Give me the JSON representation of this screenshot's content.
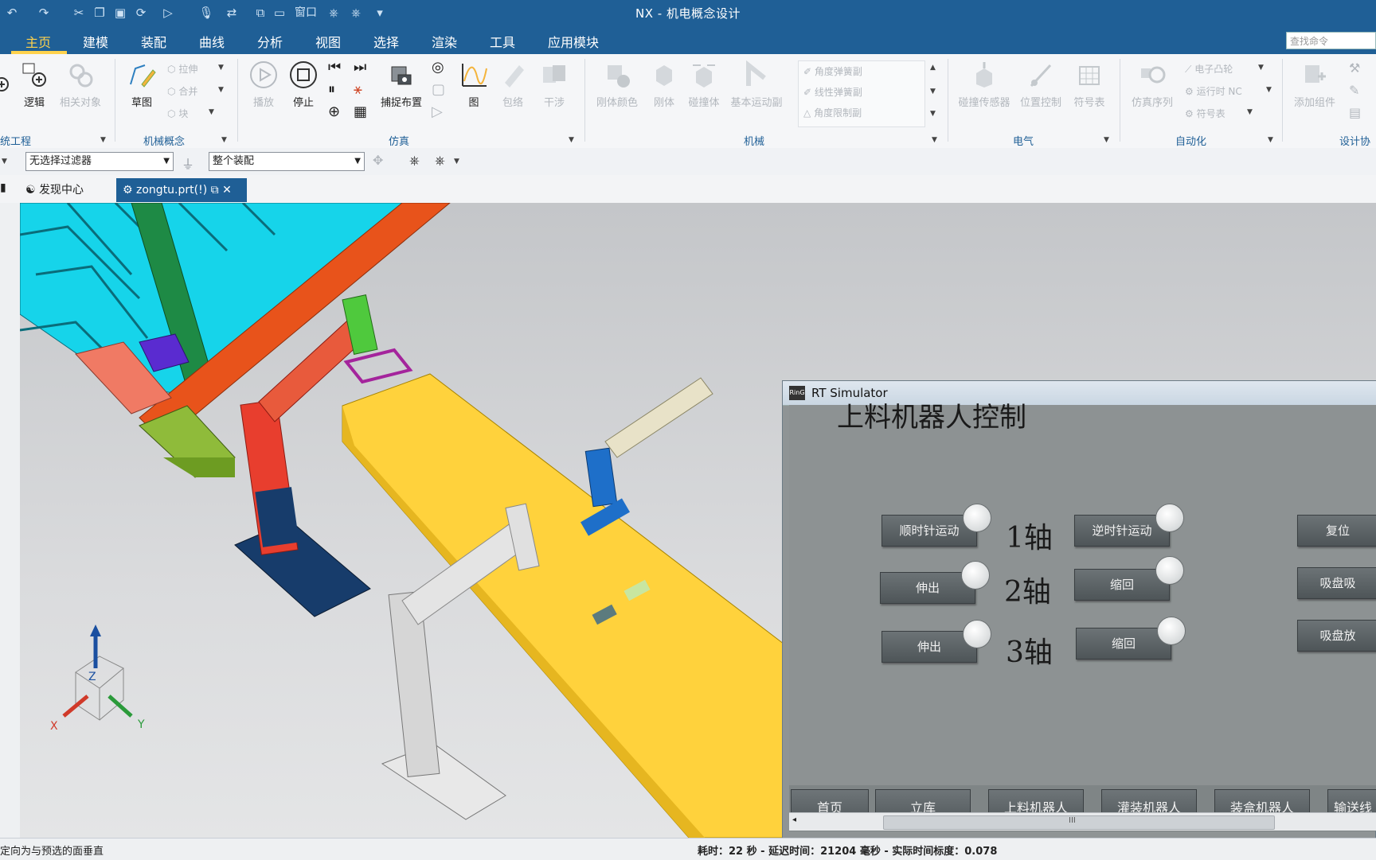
{
  "window": {
    "title": "NX - 机电概念设计"
  },
  "quick_access": {
    "window_label": "窗口"
  },
  "menu": {
    "items": [
      "主页",
      "建模",
      "装配",
      "曲线",
      "分析",
      "视图",
      "选择",
      "渲染",
      "工具",
      "应用模块"
    ]
  },
  "search": {
    "placeholder": "查找命令"
  },
  "ribbon": {
    "buttons": {
      "logic": "逻辑",
      "related": "相关对象",
      "sketch": "草图",
      "extrude": "拉伸",
      "combine": "合并",
      "block": "块",
      "play": "播放",
      "stop": "停止",
      "capture": "捕捉布置",
      "graph": "图",
      "wrap": "包络",
      "interference": "干涉",
      "body_color": "刚体颜色",
      "rigid": "刚体",
      "collision": "碰撞体",
      "basic_motion": "基本运动副",
      "angle_spring": "角度弹簧副",
      "linear_spring": "线性弹簧副",
      "angle_limit": "角度限制副",
      "collision_sensor": "碰撞传感器",
      "position_control": "位置控制",
      "symbol_table": "符号表",
      "sim_sequence": "仿真序列",
      "electronic_cam": "电子凸轮",
      "runtime_nc": "运行时 NC",
      "symbol_table2": "符号表",
      "add_component": "添加组件"
    },
    "groups": {
      "system_eng": "统工程",
      "mech_concept": "机械概念",
      "simulation": "仿真",
      "mechanical": "机械",
      "electrical": "电气",
      "automation": "自动化",
      "design_collab": "设计协"
    }
  },
  "filter": {
    "selection_filter": "无选择过滤器",
    "scope": "整个装配"
  },
  "tabs": [
    {
      "label": "发现中心",
      "active": false
    },
    {
      "label": "zongtu.prt(!)",
      "active": true
    }
  ],
  "viewport": {
    "triad": {
      "z": "Z",
      "x": "X",
      "y": "Y"
    }
  },
  "rt_simulator": {
    "title": "RT Simulator",
    "icon_text": "RinG",
    "header": "上料机器人控制",
    "rows": [
      {
        "left": "顺时针运动",
        "axis": "1轴",
        "right": "逆时针运动",
        "far": "复位"
      },
      {
        "left": "伸出",
        "axis": "2轴",
        "right": "缩回",
        "far": "吸盘吸"
      },
      {
        "left": "伸出",
        "axis": "3轴",
        "right": "缩回",
        "far": "吸盘放"
      }
    ],
    "nav": [
      "首页",
      "立库",
      "上料机器人",
      "灌装机器人",
      "装盒机器人",
      "输送线"
    ],
    "scroll_grip": "III"
  },
  "status": {
    "left": "定向为与预选的面垂直",
    "right": "耗时：22 秒 - 延迟时间：21204 毫秒 - 实际时间标度：0.078"
  },
  "colors": {
    "brand": "#1f5f96",
    "active_menu": "#ffd24d",
    "sim_panel": "#8d9293"
  }
}
